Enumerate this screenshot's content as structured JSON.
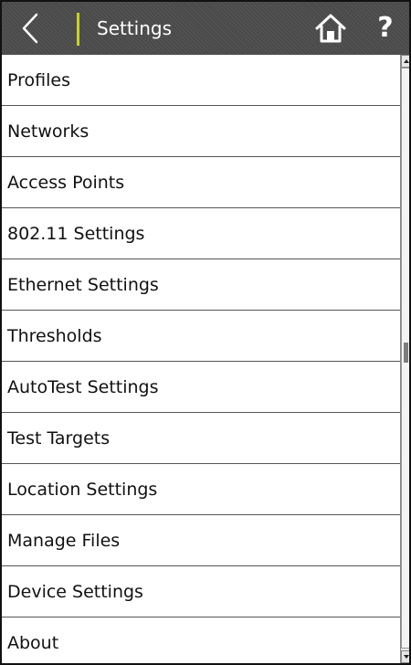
{
  "header": {
    "title": "Settings",
    "help_label": "?",
    "accent_color": "#c6d51a",
    "icons": [
      "chevron-left-icon",
      "home-icon",
      "help-icon"
    ]
  },
  "settings_list": {
    "items": [
      {
        "label": "Profiles"
      },
      {
        "label": "Networks"
      },
      {
        "label": "Access Points"
      },
      {
        "label": "802.11 Settings"
      },
      {
        "label": "Ethernet Settings"
      },
      {
        "label": "Thresholds"
      },
      {
        "label": "AutoTest Settings"
      },
      {
        "label": "Test Targets"
      },
      {
        "label": "Location Settings"
      },
      {
        "label": "Manage Files"
      },
      {
        "label": "Device Settings"
      },
      {
        "label": "About"
      }
    ]
  }
}
